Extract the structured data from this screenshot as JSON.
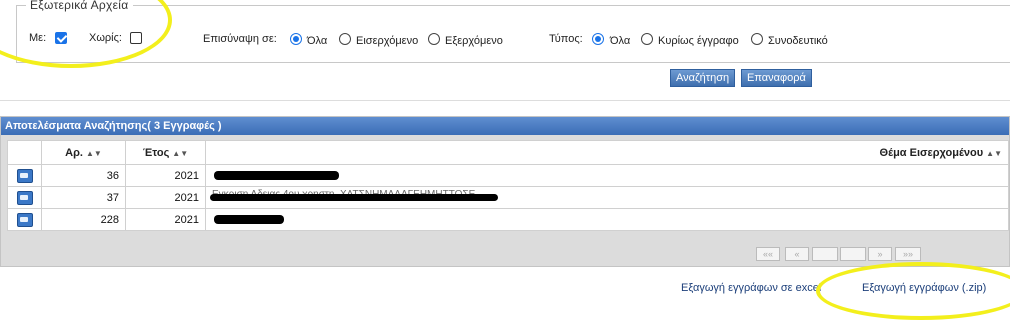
{
  "filters": {
    "legend": "Εξωτερικά Αρχεία",
    "with_label": "Με:",
    "with_checked": true,
    "without_label": "Χωρίς:",
    "without_checked": false,
    "attachment": {
      "label": "Επισύναψη σε:",
      "options": [
        "Όλα",
        "Εισερχόμενο",
        "Εξερχόμενο"
      ],
      "selected": "Όλα"
    },
    "type": {
      "label": "Τύπος:",
      "options": [
        "Όλα",
        "Κυρίως έγγραφο",
        "Συνοδευτικό"
      ],
      "selected": "Όλα"
    }
  },
  "buttons": {
    "search": "Αναζήτηση",
    "reset": "Επαναφορά"
  },
  "results": {
    "title": "Αποτελέσματα Αναζήτησης( 3 Εγγραφές )",
    "columns": [
      "Αρ.",
      "Έτος",
      "Θέμα Εισερχομένου"
    ],
    "rows": [
      {
        "number": "36",
        "year": "2021"
      },
      {
        "number": "37",
        "year": "2021",
        "subject_fragment": "Εγκριση Αδειας 4ου χρηστη. ΧΛΤΣΝΗΜΑΛΑΓΕΗΜΗΤΤΟΣΕ"
      },
      {
        "number": "228",
        "year": "2021"
      }
    ],
    "pager": [
      "««",
      "«",
      "",
      "",
      "»",
      "»»"
    ]
  },
  "export": {
    "excel": "Εξαγωγή εγγράφων σε excel",
    "zip": "Εξαγωγή εγγράφων (.zip)"
  },
  "colors": {
    "accent": "#1a73e8",
    "header_gradient": "#3b6db6",
    "highlight": "#f3ef1c",
    "link": "#1c3f7a"
  }
}
